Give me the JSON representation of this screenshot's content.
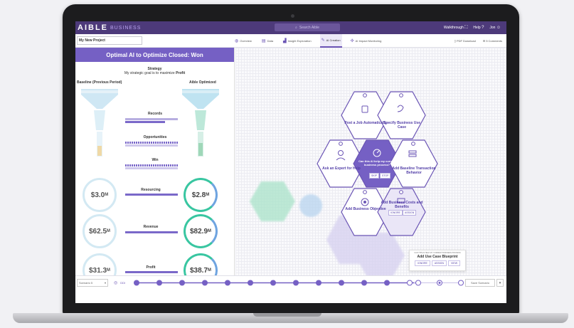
{
  "app": {
    "logo": "AIBLE",
    "logo_sub": "BUSINESS",
    "search_placeholder": "Search Aible"
  },
  "topbar": {
    "walkthrough": "Walkthrough",
    "help": "Help",
    "user": "Jon"
  },
  "project": {
    "name": "My New Project"
  },
  "tabs": [
    {
      "label": "Overview",
      "icon": "globe-icon"
    },
    {
      "label": "Data",
      "icon": "database-icon"
    },
    {
      "label": "Insight Exploration",
      "icon": "chart-icon"
    },
    {
      "label": "AI Creation",
      "icon": "wand-icon",
      "active": true
    },
    {
      "label": "AI Impact Monitoring",
      "icon": "monitor-icon"
    }
  ],
  "toolbar_right": {
    "pdf": "PDF Download",
    "comments": "5 Comments"
  },
  "panel": {
    "title": "Optimal AI to Optimize Closed: Won",
    "strategy_title": "Strategy",
    "strategy_prefix": "My strategic goal is to maximize ",
    "strategy_goal": "Profit",
    "baseline_label": "Baseline (Previous Period)",
    "optimized_label": "Aible Optimized",
    "funnel_metrics": [
      "Records",
      "Opportunities",
      "Win"
    ],
    "values": [
      {
        "label": "Resourcing",
        "baseline": "$3.0",
        "baseline_unit": "M",
        "optimized": "$2.8",
        "optimized_unit": "M"
      },
      {
        "label": "Revenue",
        "baseline": "$62.5",
        "baseline_unit": "M",
        "optimized": "$82.9",
        "optimized_unit": "M"
      },
      {
        "label": "Profit",
        "baseline": "$31.3",
        "baseline_unit": "M",
        "optimized": "$38.7",
        "optimized_unit": "M"
      }
    ]
  },
  "hexes": {
    "post_job": "Post a Job Automatically",
    "specify": "Specify Business Use Case",
    "expert": "Ask an Expert for Help",
    "center": "Can this AI help my current business process?",
    "center_btn1": "SKIP",
    "center_btn2": "STOP",
    "baseline": "Add Baseline Transaction Behavior",
    "objective": "Add Business Objective",
    "costs": "Add Business Costs and Benefits",
    "costs_btn1": "IGNORE",
    "costs_btn2": "ASSIGN"
  },
  "blueprint": {
    "small": "CAN THIS AI HELP MY CURRENT BUSINESS PROCESS",
    "title": "Add Use Case Blueprint",
    "buttons": [
      "IGNORE",
      "ASSIGN",
      "VIEW"
    ]
  },
  "timeline": {
    "scenario": "Scenario 5",
    "ddi": "DDI",
    "save": "Save Scenario"
  },
  "colors": {
    "brand": "#4d3a7a",
    "accent": "#6b55b5",
    "teal": "#39c6a1"
  }
}
